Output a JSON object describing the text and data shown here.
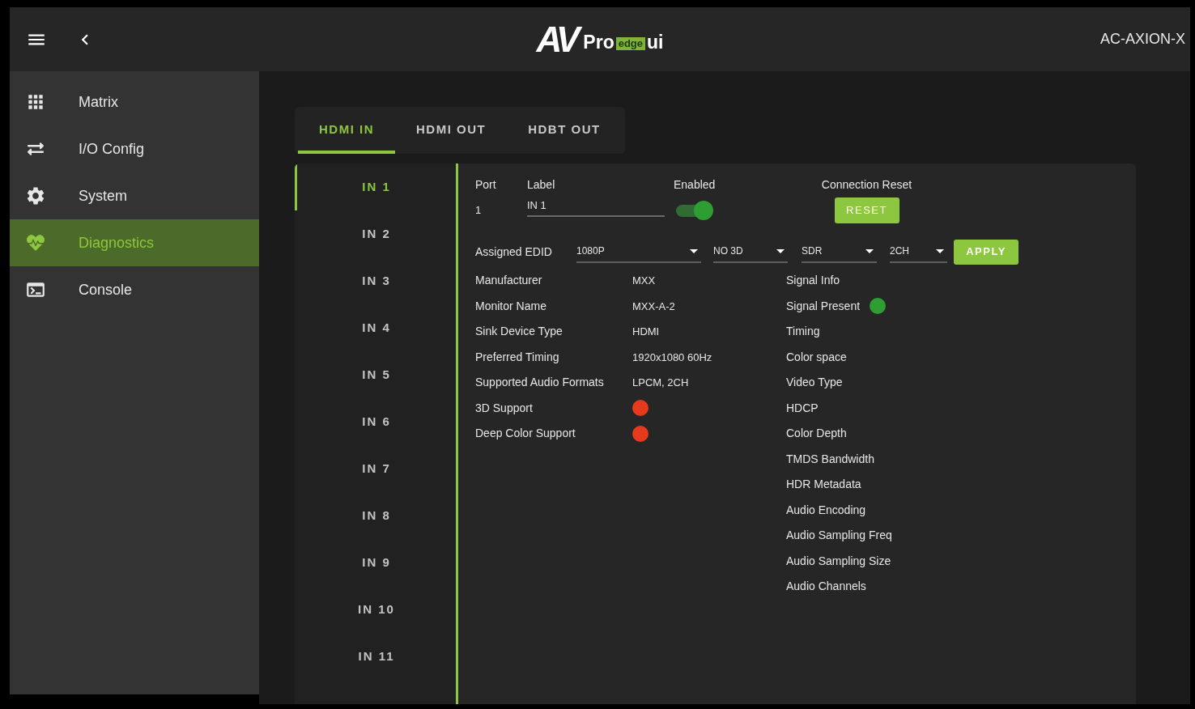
{
  "header": {
    "logo": {
      "mark": "AV",
      "name": "Pro",
      "badge": "edge",
      "suffix": "ui"
    },
    "device": "AC-AXION-X"
  },
  "sidebar": {
    "items": [
      {
        "label": "Matrix",
        "selected": false
      },
      {
        "label": "I/O Config",
        "selected": false
      },
      {
        "label": "System",
        "selected": false
      },
      {
        "label": "Diagnostics",
        "selected": true
      },
      {
        "label": "Console",
        "selected": false
      }
    ]
  },
  "tabs": [
    {
      "label": "HDMI IN",
      "selected": true
    },
    {
      "label": "HDMI OUT",
      "selected": false
    },
    {
      "label": "HDBT OUT",
      "selected": false
    }
  ],
  "ports": [
    {
      "label": "IN 1",
      "selected": true
    },
    {
      "label": "IN 2",
      "selected": false
    },
    {
      "label": "IN 3",
      "selected": false
    },
    {
      "label": "IN 4",
      "selected": false
    },
    {
      "label": "IN 5",
      "selected": false
    },
    {
      "label": "IN 6",
      "selected": false
    },
    {
      "label": "IN 7",
      "selected": false
    },
    {
      "label": "IN 8",
      "selected": false
    },
    {
      "label": "IN 9",
      "selected": false
    },
    {
      "label": "IN 10",
      "selected": false
    },
    {
      "label": "IN 11",
      "selected": false
    }
  ],
  "detail": {
    "port": {
      "label": "Port",
      "value": "1"
    },
    "name": {
      "label": "Label",
      "value": "IN 1"
    },
    "enabled": {
      "label": "Enabled",
      "on": true
    },
    "reset": {
      "label": "Connection Reset",
      "button": "RESET"
    },
    "edid": {
      "label": "Assigned EDID",
      "selects": [
        "1080P",
        "NO 3D",
        "SDR",
        "2CH"
      ],
      "button": "APPLY"
    },
    "sink": [
      {
        "kind": "text",
        "label": "Manufacturer",
        "value": "MXX"
      },
      {
        "kind": "text",
        "label": "Monitor Name",
        "value": "MXX-A-2"
      },
      {
        "kind": "text",
        "label": "Sink Device Type",
        "value": "HDMI"
      },
      {
        "kind": "text",
        "label": "Preferred Timing",
        "value": "1920x1080 60Hz"
      },
      {
        "kind": "text",
        "label": "Supported Audio Formats",
        "value": "LPCM, 2CH"
      },
      {
        "kind": "dot",
        "label": "3D Support",
        "color": "#e53a1e"
      },
      {
        "kind": "dot",
        "label": "Deep Color Support",
        "color": "#e53a1e"
      }
    ],
    "signal": [
      {
        "kind": "label",
        "label": "Signal Info"
      },
      {
        "kind": "dot",
        "label": "Signal Present",
        "color": "#2e9e33"
      },
      {
        "kind": "label",
        "label": "Timing"
      },
      {
        "kind": "label",
        "label": "Color space"
      },
      {
        "kind": "label",
        "label": "Video Type"
      },
      {
        "kind": "label",
        "label": "HDCP"
      },
      {
        "kind": "label",
        "label": "Color Depth"
      },
      {
        "kind": "label",
        "label": "TMDS Bandwidth"
      },
      {
        "kind": "label",
        "label": "HDR Metadata"
      },
      {
        "kind": "label",
        "label": "Audio Encoding"
      },
      {
        "kind": "label",
        "label": "Audio Sampling Freq"
      },
      {
        "kind": "label",
        "label": "Audio Sampling Size"
      },
      {
        "kind": "label",
        "label": "Audio Channels"
      }
    ]
  }
}
